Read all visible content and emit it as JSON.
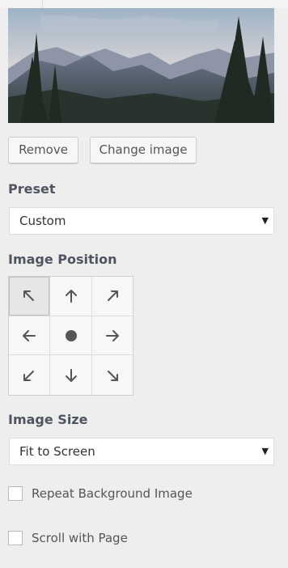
{
  "image_preview": {
    "description_icon": "landscape-image"
  },
  "buttons": {
    "remove_label": "Remove",
    "change_label": "Change image"
  },
  "preset": {
    "label": "Preset",
    "selected": "Custom"
  },
  "position": {
    "label": "Image Position",
    "selected": "top-left",
    "cells": [
      {
        "name": "top-left",
        "icon": "arrow-up-left-icon"
      },
      {
        "name": "top",
        "icon": "arrow-up-icon"
      },
      {
        "name": "top-right",
        "icon": "arrow-up-right-icon"
      },
      {
        "name": "left",
        "icon": "arrow-left-icon"
      },
      {
        "name": "center",
        "icon": "dot-icon"
      },
      {
        "name": "right",
        "icon": "arrow-right-icon"
      },
      {
        "name": "bottom-left",
        "icon": "arrow-down-left-icon"
      },
      {
        "name": "bottom",
        "icon": "arrow-down-icon"
      },
      {
        "name": "bottom-right",
        "icon": "arrow-down-right-icon"
      }
    ]
  },
  "size": {
    "label": "Image Size",
    "selected": "Fit to Screen"
  },
  "options": {
    "repeat_label": "Repeat Background Image",
    "repeat_checked": false,
    "scroll_label": "Scroll with Page",
    "scroll_checked": false
  },
  "colors": {
    "background": "#eeeeee",
    "button_bg": "#f7f7f7",
    "border": "#cccccc"
  }
}
